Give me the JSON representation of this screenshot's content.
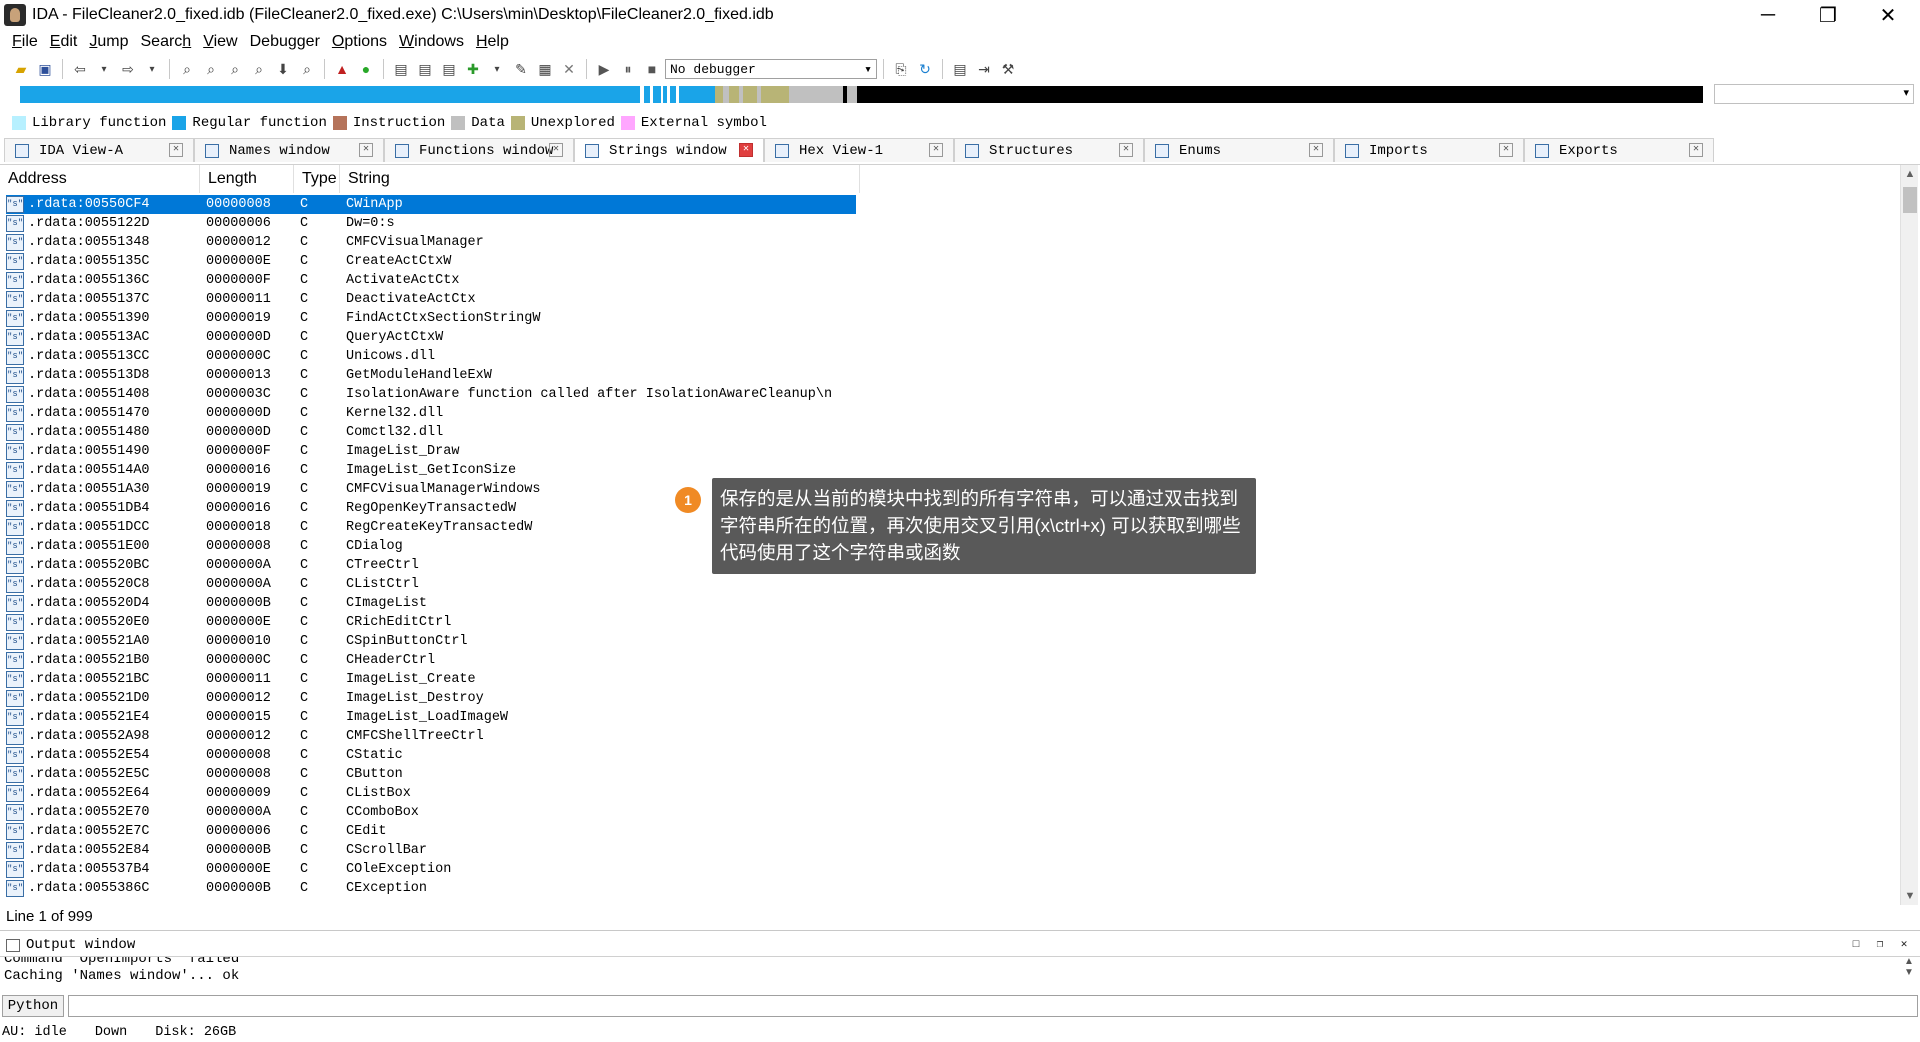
{
  "window": {
    "title": "IDA - FileCleaner2.0_fixed.idb (FileCleaner2.0_fixed.exe) C:\\Users\\min\\Desktop\\FileCleaner2.0_fixed.idb",
    "minimize": "─",
    "maximize": "❐",
    "close": "✕"
  },
  "menu": [
    {
      "pre": "",
      "u": "F",
      "post": "ile"
    },
    {
      "pre": "",
      "u": "E",
      "post": "dit"
    },
    {
      "pre": "",
      "u": "J",
      "post": "ump"
    },
    {
      "pre": "Searc",
      "u": "h",
      "post": ""
    },
    {
      "pre": "",
      "u": "V",
      "post": "iew"
    },
    {
      "pre": "Debu",
      "u": "g",
      "post": "ger"
    },
    {
      "pre": "",
      "u": "O",
      "post": "ptions"
    },
    {
      "pre": "",
      "u": "W",
      "post": "indows"
    },
    {
      "pre": "",
      "u": "H",
      "post": "elp"
    }
  ],
  "toolbar": {
    "debugger_value": "No debugger",
    "dropdown_arrow": "▾"
  },
  "legend": [
    {
      "label": "Library function",
      "color": "#b7f0ff"
    },
    {
      "label": "Regular function",
      "color": "#1aa4e8"
    },
    {
      "label": "Instruction",
      "color": "#b5735a"
    },
    {
      "label": "Data",
      "color": "#c0c0c0"
    },
    {
      "label": "Unexplored",
      "color": "#b8b476"
    },
    {
      "label": "External symbol",
      "color": "#ffa6ff"
    }
  ],
  "tabs": [
    {
      "label": "IDA View-A",
      "active": false
    },
    {
      "label": "Names window",
      "active": false
    },
    {
      "label": "Functions window",
      "active": false
    },
    {
      "label": "Strings window",
      "active": true
    },
    {
      "label": "Hex View-1",
      "active": false
    },
    {
      "label": "Structures",
      "active": false
    },
    {
      "label": "Enums",
      "active": false
    },
    {
      "label": "Imports",
      "active": false
    },
    {
      "label": "Exports",
      "active": false
    }
  ],
  "tab_close_glyph": "✕",
  "strings": {
    "columns": [
      "Address",
      "Length",
      "Type",
      "String"
    ],
    "rows": [
      {
        "addr": ".rdata:00550CF4",
        "len": "00000008",
        "type": "C",
        "str": "CWinApp"
      },
      {
        "addr": ".rdata:0055122D",
        "len": "00000006",
        "type": "C",
        "str": "Dw=0:s"
      },
      {
        "addr": ".rdata:00551348",
        "len": "00000012",
        "type": "C",
        "str": "CMFCVisualManager"
      },
      {
        "addr": ".rdata:0055135C",
        "len": "0000000E",
        "type": "C",
        "str": "CreateActCtxW"
      },
      {
        "addr": ".rdata:0055136C",
        "len": "0000000F",
        "type": "C",
        "str": "ActivateActCtx"
      },
      {
        "addr": ".rdata:0055137C",
        "len": "00000011",
        "type": "C",
        "str": "DeactivateActCtx"
      },
      {
        "addr": ".rdata:00551390",
        "len": "00000019",
        "type": "C",
        "str": "FindActCtxSectionStringW"
      },
      {
        "addr": ".rdata:005513AC",
        "len": "0000000D",
        "type": "C",
        "str": "QueryActCtxW"
      },
      {
        "addr": ".rdata:005513CC",
        "len": "0000000C",
        "type": "C",
        "str": "Unicows.dll"
      },
      {
        "addr": ".rdata:005513D8",
        "len": "00000013",
        "type": "C",
        "str": "GetModuleHandleExW"
      },
      {
        "addr": ".rdata:00551408",
        "len": "0000003C",
        "type": "C",
        "str": "IsolationAware function called after IsolationAwareCleanup\\n"
      },
      {
        "addr": ".rdata:00551470",
        "len": "0000000D",
        "type": "C",
        "str": "Kernel32.dll"
      },
      {
        "addr": ".rdata:00551480",
        "len": "0000000D",
        "type": "C",
        "str": "Comctl32.dll"
      },
      {
        "addr": ".rdata:00551490",
        "len": "0000000F",
        "type": "C",
        "str": "ImageList_Draw"
      },
      {
        "addr": ".rdata:005514A0",
        "len": "00000016",
        "type": "C",
        "str": "ImageList_GetIconSize"
      },
      {
        "addr": ".rdata:00551A30",
        "len": "00000019",
        "type": "C",
        "str": "CMFCVisualManagerWindows"
      },
      {
        "addr": ".rdata:00551DB4",
        "len": "00000016",
        "type": "C",
        "str": "RegOpenKeyTransactedW"
      },
      {
        "addr": ".rdata:00551DCC",
        "len": "00000018",
        "type": "C",
        "str": "RegCreateKeyTransactedW"
      },
      {
        "addr": ".rdata:00551E00",
        "len": "00000008",
        "type": "C",
        "str": "CDialog"
      },
      {
        "addr": ".rdata:005520BC",
        "len": "0000000A",
        "type": "C",
        "str": "CTreeCtrl"
      },
      {
        "addr": ".rdata:005520C8",
        "len": "0000000A",
        "type": "C",
        "str": "CListCtrl"
      },
      {
        "addr": ".rdata:005520D4",
        "len": "0000000B",
        "type": "C",
        "str": "CImageList"
      },
      {
        "addr": ".rdata:005520E0",
        "len": "0000000E",
        "type": "C",
        "str": "CRichEditCtrl"
      },
      {
        "addr": ".rdata:005521A0",
        "len": "00000010",
        "type": "C",
        "str": "CSpinButtonCtrl"
      },
      {
        "addr": ".rdata:005521B0",
        "len": "0000000C",
        "type": "C",
        "str": "CHeaderCtrl"
      },
      {
        "addr": ".rdata:005521BC",
        "len": "00000011",
        "type": "C",
        "str": "ImageList_Create"
      },
      {
        "addr": ".rdata:005521D0",
        "len": "00000012",
        "type": "C",
        "str": "ImageList_Destroy"
      },
      {
        "addr": ".rdata:005521E4",
        "len": "00000015",
        "type": "C",
        "str": "ImageList_LoadImageW"
      },
      {
        "addr": ".rdata:00552A98",
        "len": "00000012",
        "type": "C",
        "str": "CMFCShellTreeCtrl"
      },
      {
        "addr": ".rdata:00552E54",
        "len": "00000008",
        "type": "C",
        "str": "CStatic"
      },
      {
        "addr": ".rdata:00552E5C",
        "len": "00000008",
        "type": "C",
        "str": "CButton"
      },
      {
        "addr": ".rdata:00552E64",
        "len": "00000009",
        "type": "C",
        "str": "CListBox"
      },
      {
        "addr": ".rdata:00552E70",
        "len": "0000000A",
        "type": "C",
        "str": "CComboBox"
      },
      {
        "addr": ".rdata:00552E7C",
        "len": "00000006",
        "type": "C",
        "str": "CEdit"
      },
      {
        "addr": ".rdata:00552E84",
        "len": "0000000B",
        "type": "C",
        "str": "CScrollBar"
      },
      {
        "addr": ".rdata:005537B4",
        "len": "0000000E",
        "type": "C",
        "str": "COleException"
      },
      {
        "addr": ".rdata:0055386C",
        "len": "0000000B",
        "type": "C",
        "str": "CException"
      }
    ],
    "selected_index": 0,
    "row_icon": "\"s\"",
    "scroll_up": "▲",
    "scroll_down": "▼"
  },
  "line_status": "Line 1 of 999",
  "output": {
    "title": "Output window",
    "lines": [
      "Command \"OpenImports\" failed",
      "Caching 'Names window'... ok"
    ],
    "controls": [
      "□",
      "❐",
      "✕"
    ]
  },
  "python_button": "Python",
  "statusbar": [
    "AU:  idle",
    "Down",
    "Disk: 26GB"
  ],
  "callout": {
    "number": "1",
    "text": "保存的是从当前的模块中找到的所有字符串，可以通过双击找到字符串所在的位置，再次使用交叉引用(x\\ctrl+x) 可以获取到哪些代码使用了这个字符串或函数"
  },
  "navband_colors": {
    "lib": "#00aaf0",
    "code": "#1aa4e8",
    "data": "#c0c0c0",
    "unexp": "#b8b476",
    "ext": "#000000"
  }
}
